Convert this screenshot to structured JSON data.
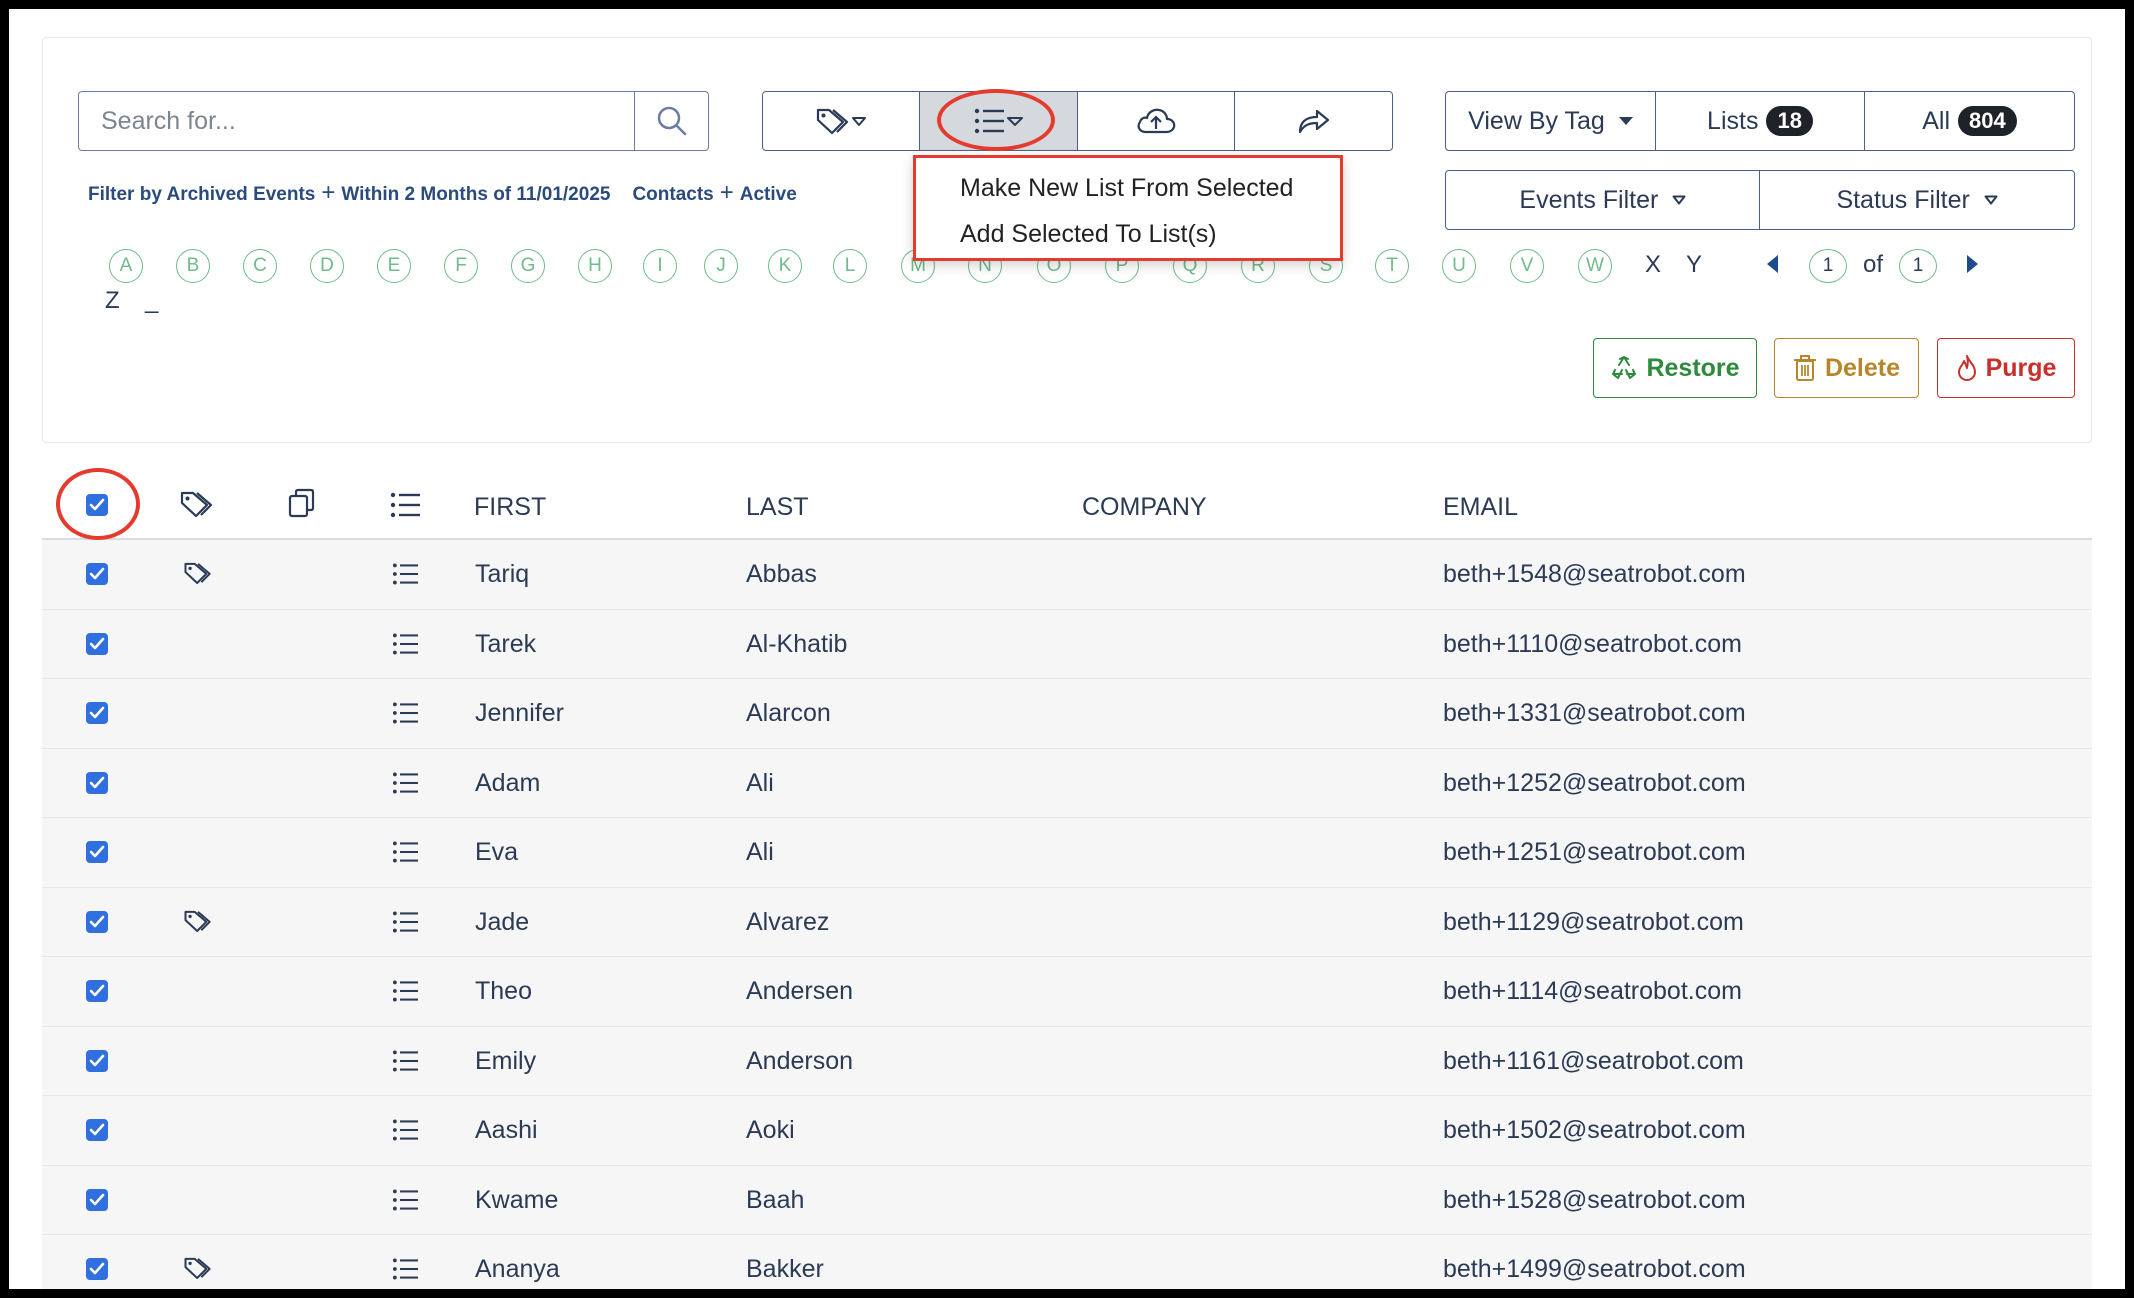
{
  "search": {
    "placeholder": "Search for..."
  },
  "filter_summary": {
    "part1": "Filter by Archived Events",
    "part2": "Within 2 Months of 11/01/2025",
    "part3": "Contacts",
    "part4": "Active",
    "plus": "+"
  },
  "view": {
    "by_tag": "View By Tag",
    "lists_label": "Lists",
    "lists_count": "18",
    "all_label": "All",
    "all_count": "804"
  },
  "filters": {
    "events": "Events Filter",
    "status": "Status Filter"
  },
  "dropdown": {
    "items": [
      "Make New List From Selected",
      "Add Selected To List(s)"
    ]
  },
  "alphabet": {
    "circled": [
      "A",
      "B",
      "C",
      "D",
      "E",
      "F",
      "G",
      "H",
      "I",
      "J",
      "K",
      "L",
      "M",
      "N",
      "O",
      "P",
      "Q",
      "R",
      "S",
      "T",
      "U",
      "V",
      "W"
    ],
    "plain": [
      "X",
      "Y",
      "Z",
      "_"
    ]
  },
  "pager": {
    "current": "1",
    "of": "of",
    "total": "1"
  },
  "actions": {
    "restore": "Restore",
    "delete": "Delete",
    "purge": "Purge"
  },
  "table": {
    "headers": {
      "first": "FIRST",
      "last": "LAST",
      "company": "COMPANY",
      "email": "EMAIL"
    },
    "rows": [
      {
        "first": "Tariq",
        "last": "Abbas",
        "company": "",
        "email": "beth+1548@seatrobot.com",
        "tagged": true
      },
      {
        "first": "Tarek",
        "last": "Al-Khatib",
        "company": "",
        "email": "beth+1110@seatrobot.com",
        "tagged": false
      },
      {
        "first": "Jennifer",
        "last": "Alarcon",
        "company": "",
        "email": "beth+1331@seatrobot.com",
        "tagged": false
      },
      {
        "first": "Adam",
        "last": "Ali",
        "company": "",
        "email": "beth+1252@seatrobot.com",
        "tagged": false
      },
      {
        "first": "Eva",
        "last": "Ali",
        "company": "",
        "email": "beth+1251@seatrobot.com",
        "tagged": false
      },
      {
        "first": "Jade",
        "last": "Alvarez",
        "company": "",
        "email": "beth+1129@seatrobot.com",
        "tagged": true
      },
      {
        "first": "Theo",
        "last": "Andersen",
        "company": "",
        "email": "beth+1114@seatrobot.com",
        "tagged": false
      },
      {
        "first": "Emily",
        "last": "Anderson",
        "company": "",
        "email": "beth+1161@seatrobot.com",
        "tagged": false
      },
      {
        "first": "Aashi",
        "last": "Aoki",
        "company": "",
        "email": "beth+1502@seatrobot.com",
        "tagged": false
      },
      {
        "first": "Kwame",
        "last": "Baah",
        "company": "",
        "email": "beth+1528@seatrobot.com",
        "tagged": false
      },
      {
        "first": "Ananya",
        "last": "Bakker",
        "company": "",
        "email": "beth+1499@seatrobot.com",
        "tagged": true
      }
    ]
  },
  "colors": {
    "accent": "#2f6fe0",
    "highlight": "#e53a2e",
    "letter_green": "#6fbb8a",
    "restore": "#2e8b3e",
    "delete": "#b8862a",
    "purge": "#c9302c"
  }
}
